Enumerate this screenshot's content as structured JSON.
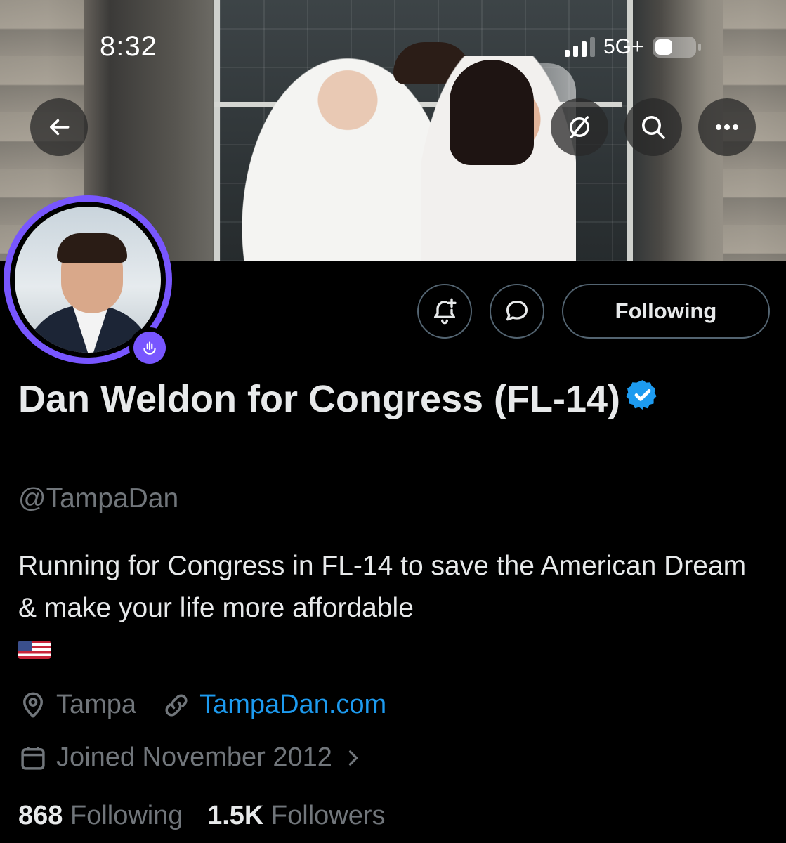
{
  "status_bar": {
    "time": "8:32",
    "network": "5G+"
  },
  "nav": {
    "back_icon": "arrow-left-icon",
    "grok_icon": "slashed-circle-icon",
    "search_icon": "search-icon",
    "more_icon": "more-horizontal-icon"
  },
  "actions": {
    "notify_icon": "bell-plus-icon",
    "message_icon": "message-bubble-icon",
    "following_label": "Following"
  },
  "profile": {
    "display_name": "Dan Weldon for Congress (FL-14)",
    "verified_icon": "verified-badge-icon",
    "handle": "@TampaDan",
    "bio": "Running for Congress in FL-14 to save the American Dream & make your life more affordable",
    "bio_flag_icon": "us-flag-emoji",
    "location": "Tampa",
    "website": "TampaDan.com",
    "joined": "Joined November 2012",
    "following_count": "868",
    "following_label": "Following",
    "followers_count": "1.5K",
    "followers_label": "Followers"
  },
  "colors": {
    "accent_blue": "#1d9bf0",
    "avatar_ring": "#7856ff",
    "muted_text": "#71767b"
  }
}
